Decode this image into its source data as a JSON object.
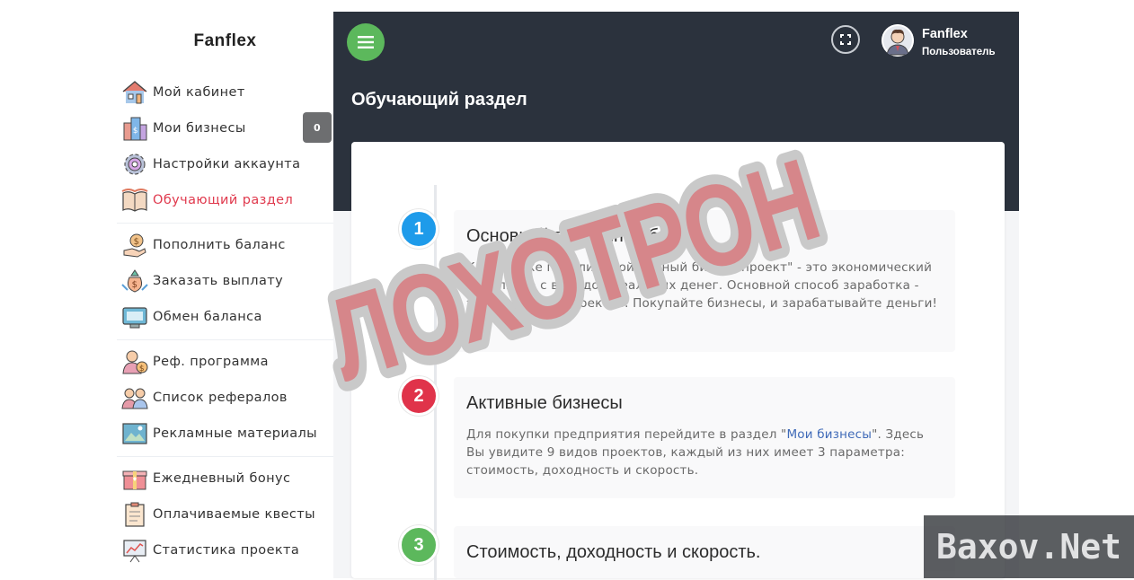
{
  "sidebar": {
    "brand": "Fanflex",
    "items": [
      {
        "label": "Мой кабинет",
        "icon": "house-icon"
      },
      {
        "label": "Мои бизнесы",
        "icon": "building-icon",
        "badge": "0"
      },
      {
        "label": "Настройки аккаунта",
        "icon": "gear-icon"
      },
      {
        "label": "Обучающий раздел",
        "icon": "book-icon",
        "active": true
      },
      {
        "label": "Пополнить баланс",
        "icon": "money-hand-icon"
      },
      {
        "label": "Заказать выплату",
        "icon": "money-bag-icon"
      },
      {
        "label": "Обмен баланса",
        "icon": "monitor-icon"
      },
      {
        "label": "Реф. программа",
        "icon": "referral-program-icon"
      },
      {
        "label": "Список рефералов",
        "icon": "people-icon"
      },
      {
        "label": "Рекламные материалы",
        "icon": "image-icon"
      },
      {
        "label": "Ежедневный бонус",
        "icon": "gift-icon"
      },
      {
        "label": "Оплачиваемые квесты",
        "icon": "checklist-icon"
      },
      {
        "label": "Статистика проекта",
        "icon": "chart-board-icon"
      }
    ]
  },
  "header": {
    "user_name": "Fanflex",
    "user_role": "Пользователь",
    "page_title": "Обучающий раздел"
  },
  "steps": [
    {
      "number": "1",
      "color": "#1e9bea",
      "title": "Основной принцип работы",
      "text": "Как Вы уже поняли \"Твой личный бизнес-проект\" - это экономический симулятор с выводом реальных денег. Основной способ заработка - это прибыль с проектов. Покупайте бизнесы, и зарабатывайте деньги!"
    },
    {
      "number": "2",
      "color": "#e0334a",
      "title": "Активные бизнесы",
      "text_before": "Для покупки предприятия перейдите в раздел \"",
      "link": "Мои бизнесы",
      "text_after": "\". Здесь Вы увидите 9 видов проектов, каждый из них имеет 3 параметра: стоимость, доходность и скорость."
    },
    {
      "number": "3",
      "color": "#5cb85c",
      "title": "Стоимость, доходность и скорость."
    }
  ],
  "stamp": {
    "text": "ЛОХОТРОН",
    "color": "#d9787c"
  },
  "watermark": {
    "text": "Baxov.Net"
  }
}
